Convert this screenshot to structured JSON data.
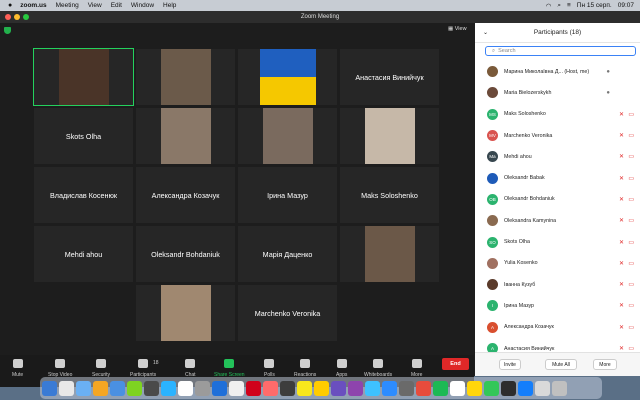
{
  "menubar": {
    "app": "zoom.us",
    "items": [
      "Meeting",
      "View",
      "Edit",
      "Window",
      "Help"
    ],
    "date": "Пн 15 серп.",
    "time": "09:07"
  },
  "window": {
    "title": "Zoom Meeting",
    "view_label": "View"
  },
  "tiles": [
    {
      "name": "",
      "photo": true,
      "active": true
    },
    {
      "name": "",
      "photo": true
    },
    {
      "name": "",
      "flag": true
    },
    {
      "name": "Анастасия Винийчук"
    },
    {
      "name": "Skots Olha"
    },
    {
      "name": "",
      "photo": true
    },
    {
      "name": "",
      "photo": true
    },
    {
      "name": "",
      "photo": true
    },
    {
      "name": "Владислав Косенюк"
    },
    {
      "name": "Александра Козачук"
    },
    {
      "name": "Ірина Мазур"
    },
    {
      "name": "Maks Soloshenko"
    },
    {
      "name": "Mehdi ahou"
    },
    {
      "name": "Oleksandr Bohdaniuk"
    },
    {
      "name": "Марія Даценко"
    },
    {
      "name": "",
      "photo": true
    },
    {
      "name": "",
      "photo": true
    },
    {
      "name": "Marchenko Veronika"
    }
  ],
  "toolbar": {
    "mute": "Mute",
    "stop_video": "Stop Video",
    "security": "Security",
    "participants": "Participants",
    "participants_count": "18",
    "chat": "Chat",
    "share_screen": "Share Screen",
    "polls": "Polls",
    "reactions": "Reactions",
    "apps": "Apps",
    "whiteboards": "Whiteboards",
    "more": "More",
    "end": "End"
  },
  "panel": {
    "title": "Participants (18)",
    "search_placeholder": "Search",
    "participants": [
      {
        "name": "Марина Миколаївна Д... (Host, me)",
        "initials": "",
        "color": "#7a5a3a",
        "muted": false
      },
      {
        "name": "Maria Bielozerskykh",
        "initials": "",
        "color": "#6b4a3a",
        "muted": false
      },
      {
        "name": "Maks Soloshenko",
        "initials": "MS",
        "color": "#2bb36e",
        "muted": true
      },
      {
        "name": "Marchenko Veronika",
        "initials": "MV",
        "color": "#d9534f",
        "muted": true
      },
      {
        "name": "Mehdi ahou",
        "initials": "Ma",
        "color": "#37474f",
        "muted": true
      },
      {
        "name": "Oleksandr Babak",
        "initials": "",
        "color": "#1e5bb8",
        "muted": true
      },
      {
        "name": "Oleksandr Bohdaniuk",
        "initials": "OB",
        "color": "#2bb36e",
        "muted": true
      },
      {
        "name": "Oleksandra Kamynina",
        "initials": "",
        "color": "#8a6a50",
        "muted": true
      },
      {
        "name": "Skots Olha",
        "initials": "SO",
        "color": "#2bb36e",
        "muted": true
      },
      {
        "name": "Yulia Kosenko",
        "initials": "",
        "color": "#a07060",
        "muted": true
      },
      {
        "name": "Іванна Кузуб",
        "initials": "",
        "color": "#5a3a2a",
        "muted": true
      },
      {
        "name": "Ірина Мазур",
        "initials": "І",
        "color": "#2bb36e",
        "muted": true
      },
      {
        "name": "Александра Козачук",
        "initials": "А",
        "color": "#d94f2f",
        "muted": true
      },
      {
        "name": "Анастасия Винийчук",
        "initials": "А",
        "color": "#2bb36e",
        "muted": true
      }
    ],
    "invite": "Invite",
    "mute_all": "Mute All",
    "more": "More"
  },
  "colors": {
    "accent_green": "#24d15d",
    "end_red": "#e02828",
    "search_blue": "#3b82f6"
  }
}
